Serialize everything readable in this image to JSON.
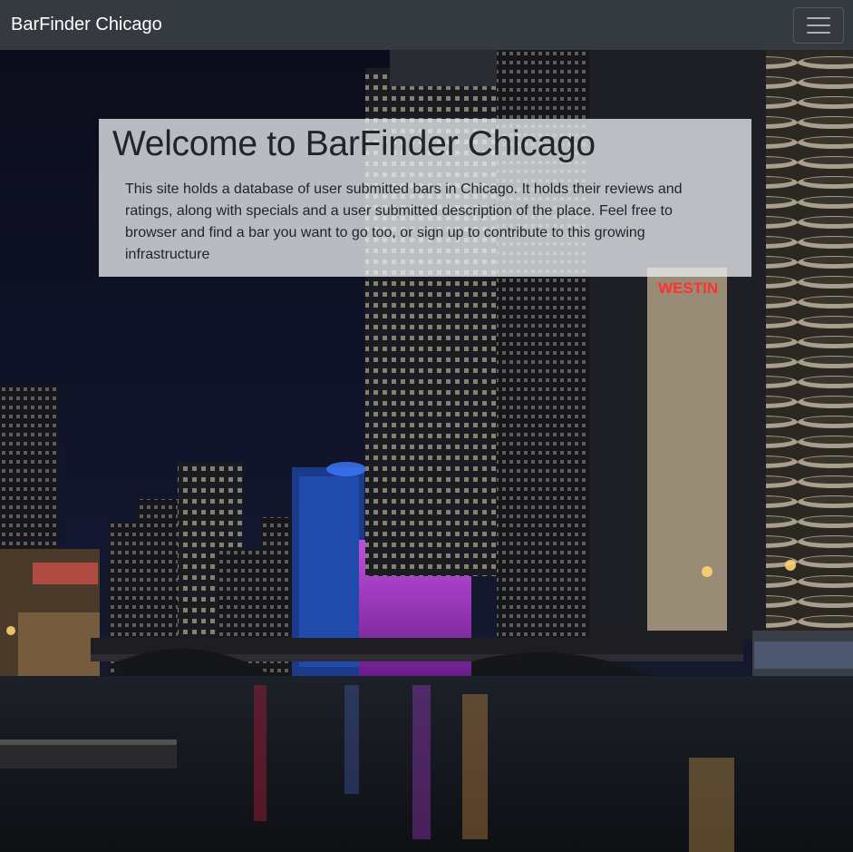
{
  "navbar": {
    "brand": "BarFinder Chicago",
    "toggler_icon": "hamburger-menu-icon"
  },
  "jumbotron": {
    "title": "Welcome to BarFinder Chicago",
    "description": "This site holds a database of user submitted bars in Chicago. It holds their reviews and ratings, along with specials and a user submitted description of the place. Feel free to browser and find a bar you want to go too, or sign up to contribute to this growing infrastructure"
  },
  "hero": {
    "sign_text": "WESTIN"
  },
  "colors": {
    "navbar_bg": "#343a40",
    "jumbotron_bg": "#e9ecef",
    "text": "#212529"
  }
}
